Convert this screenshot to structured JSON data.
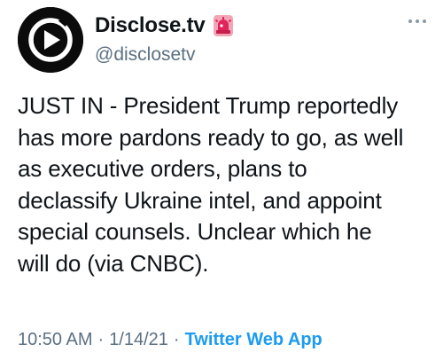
{
  "author": {
    "display_name": "Disclose.tv",
    "handle": "@disclosetv",
    "avatar_icon": "play-logo-icon",
    "badge_icon": "siren-icon"
  },
  "menu": {
    "more_icon": "more-options-icon"
  },
  "tweet": {
    "text": "JUST IN - President Trump reportedly\nhas more pardons ready to go, as well\nas executive orders, plans to\ndeclassify Ukraine intel, and appoint\nspecial counsels. Unclear which he\nwill do (via CNBC).",
    "time": "10:50 AM",
    "separator": "·",
    "date": "1/14/21",
    "source": "Twitter Web App"
  },
  "colors": {
    "text": "#0f1419",
    "secondary": "#5b7083",
    "accent": "#1d9bf0",
    "siren": "#e0245e"
  }
}
